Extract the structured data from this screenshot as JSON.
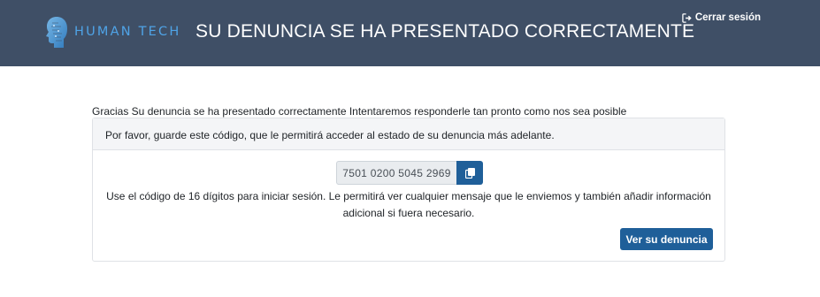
{
  "header": {
    "logo_text": "HUMAN TECH",
    "title": "SU DENUNCIA SE HA PRESENTADO CORRECTAMENTE",
    "logout_label": "Cerrar sesión",
    "logout_icon": "sign-out-icon",
    "logo_icon": "human-profile-logo-icon",
    "background_color": "#3f4f66",
    "logo_color": "#4fa3e6"
  },
  "main": {
    "thanks_text": "Gracias Su denuncia se ha presentado correctamente Intentaremos responderle tan pronto como nos sea posible",
    "card": {
      "header_text": "Por favor, guarde este código, que le permitirá acceder al estado de su denuncia más adelante.",
      "code_value": "7501 0200 5045 2969",
      "copy_icon": "copy-icon",
      "help_text_line1": "Use el código de 16 dígitos para iniciar sesión. Le permitirá ver cualquier mensaje que le enviemos y también añadir información",
      "help_text_line2": "adicional si fuera necesario.",
      "view_button_label": "Ver su denuncia",
      "accent_color": "#1f5f99"
    }
  }
}
